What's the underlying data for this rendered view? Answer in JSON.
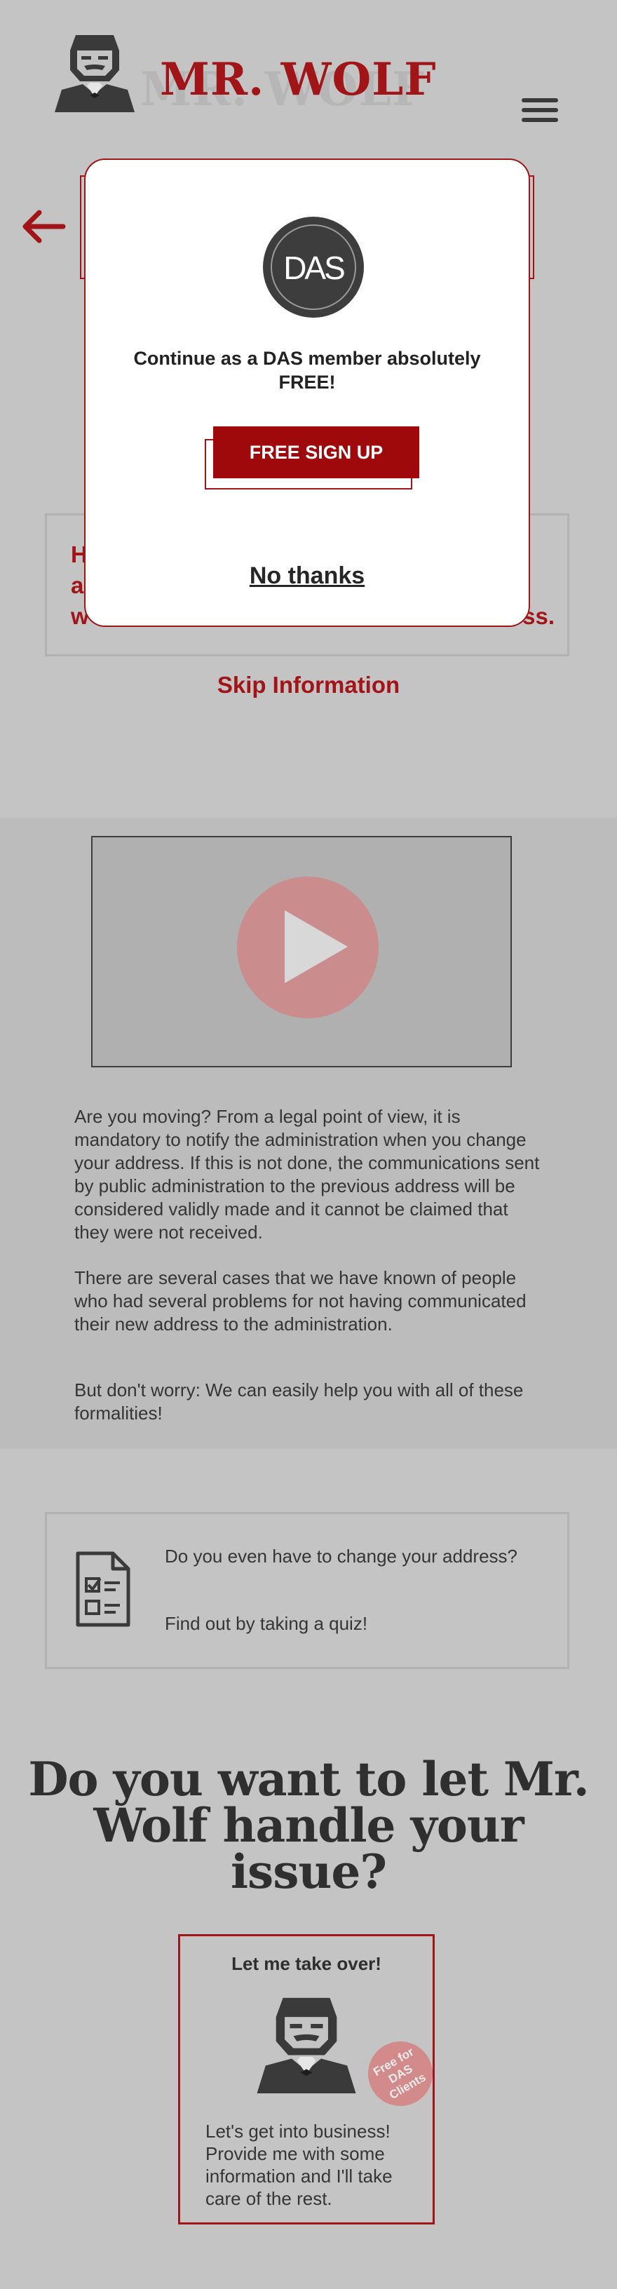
{
  "header": {
    "logo_text": "MR. WOLF",
    "menu_icon": "hamburger-menu-icon"
  },
  "back": {
    "icon": "arrow-left-icon"
  },
  "info_box": {
    "visible_line1": "H",
    "visible_line2": "a",
    "visible_line3": "w",
    "visible_line3_end": "ss."
  },
  "skip_link": "Skip Information",
  "video": {
    "icon": "play-icon"
  },
  "paragraphs": [
    "Are you moving? From a legal point of view, it is mandatory to notify the administration when you change your address. If this is not done, the communications sent by public administration to the previous address will be considered validly made and it cannot be claimed that they were not received.",
    "There are several cases that we have known of people who had several problems for not having communicated their new address to the administration.",
    "But don't worry: We can easily help you with all of these formalities!"
  ],
  "quiz": {
    "icon": "document-checklist-icon",
    "question": "Do you even have to change your address?",
    "cta": "Find out by taking a quiz!"
  },
  "headline": "Do you want to let Mr. Wolf handle your issue?",
  "card": {
    "title": "Let me take over!",
    "badge": "Free for DAS Clients",
    "text": "Let's get into business! Provide me with some information and I'll take care of the rest."
  },
  "modal": {
    "logo_text": "DAS",
    "title": "Continue as a DAS member absolutely FREE!",
    "signup_label": "FREE SIGN UP",
    "dismiss_label": "No thanks"
  },
  "colors": {
    "brand_red": "#a11417",
    "background": "#c4c4c4",
    "band": "#bcbcbc",
    "text_dark": "#353535"
  }
}
